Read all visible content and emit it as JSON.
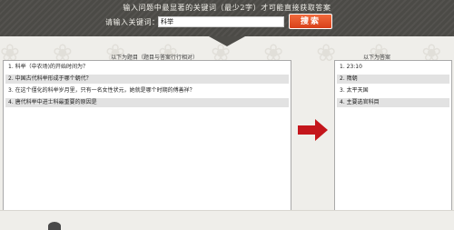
{
  "header": {
    "instruction": "输入问题中最显著的关键词（最少2字）才可能直接获取答案",
    "search_label": "请输入关键词：",
    "search_value": "科举",
    "search_button": "搜索"
  },
  "questions": {
    "title": "以下为题目（题目与答案行行相对）",
    "items": [
      "1. 科举（中农场)的开始时间为？",
      "2. 中国古代科举形成于哪个朝代？",
      "3. 在这个僵化的科举岁月里，只有一名女性状元，她就是哪个时期的傅善祥？",
      "4. 唐代科举中进士科最重要的原因是"
    ]
  },
  "answers": {
    "title": "以下为答案",
    "items": [
      "1. 23:10",
      "2. 隋朝",
      "3. 太平天国",
      "4. 主要选官科目"
    ]
  },
  "colors": {
    "header_bg": "#4e4d49",
    "button_bg": "#e0502a",
    "arrow": "#c4161c",
    "row_alt": "#e2e2e2"
  }
}
